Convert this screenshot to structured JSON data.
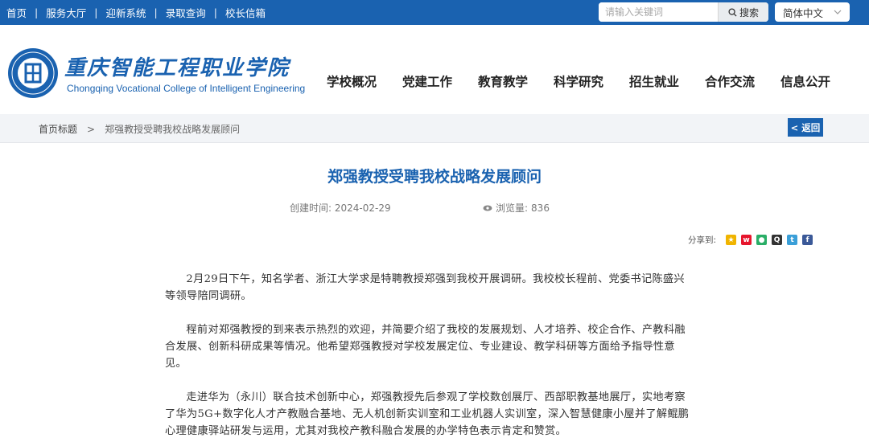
{
  "topbar": {
    "links": [
      "首页",
      "服务大厅",
      "迎新系统",
      "录取查询",
      "校长信箱"
    ],
    "separator": "|",
    "search": {
      "placeholder": "请输入关键词",
      "button_label": "搜索"
    },
    "language": {
      "selected": "简体中文"
    }
  },
  "header": {
    "school_name_cn": "重庆智能工程职业学院",
    "school_name_en": "Chongqing Vocational College of Intelligent Engineering",
    "nav": [
      "学校概况",
      "党建工作",
      "教育教学",
      "科学研究",
      "招生就业",
      "合作交流",
      "信息公开"
    ]
  },
  "breadcrumb": {
    "home": "首页标题",
    "arrow": ">",
    "current": "郑强教授受聘我校战略发展顾问",
    "back_label": "< 返回"
  },
  "article": {
    "title": "郑强教授受聘我校战略发展顾问",
    "created_label": "创建时间:",
    "created_value": "2024-02-29",
    "views_label": "浏览量:",
    "views_value": "836",
    "share_label": "分享到:",
    "share_icons": [
      "qzone-icon",
      "weibo-icon",
      "wechat-icon",
      "qq-icon",
      "tencent-weibo-icon",
      "facebook-icon"
    ],
    "paragraphs": [
      "2月29日下午，知名学者、浙江大学求是特聘教授郑强到我校开展调研。我校校长程前、党委书记陈盛兴等领导陪同调研。",
      "程前对郑强教授的到来表示热烈的欢迎，并简要介绍了我校的发展规划、人才培养、校企合作、产教科融合发展、创新科研成果等情况。他希望郑强教授对学校发展定位、专业建设、教学科研等方面给予指导性意见。",
      "走进华为（永川）联合技术创新中心，郑强教授先后参观了学校数创展厅、西部职教基地展厅，实地考察了华为5G+数字化人才产教融合基地、无人机创新实训室和工业机器人实训室，深入智慧健康小屋并了解鲲鹏心理健康驿站研发与运用，尤其对我校产教科融合发展的办学特色表示肯定和赞赏。"
    ]
  },
  "colors": {
    "brand_blue": "#1a62b0",
    "crumb_bg": "#f2f4f7"
  }
}
